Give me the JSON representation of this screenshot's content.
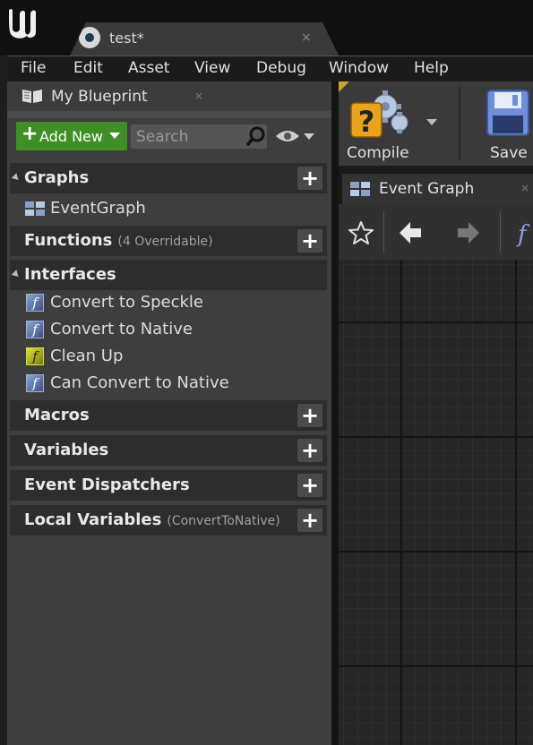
{
  "window": {
    "doc_tab_title": "test*",
    "doc_tab_close": "×"
  },
  "menu": {
    "items": [
      "File",
      "Edit",
      "Asset",
      "View",
      "Debug",
      "Window",
      "Help"
    ]
  },
  "my_blueprint": {
    "tab_label": "My Blueprint",
    "tab_close": "×",
    "add_new_label": "Add New",
    "search_placeholder": "Search",
    "sections": [
      {
        "title": "Graphs",
        "subtitle": "",
        "expanded": true,
        "items": [
          {
            "label": "EventGraph",
            "icon": "event-graph-icon"
          }
        ]
      },
      {
        "title": "Functions",
        "subtitle": "(4 Overridable)",
        "expanded": false,
        "items": []
      },
      {
        "title": "Interfaces",
        "subtitle": "",
        "expanded": true,
        "items": [
          {
            "label": "Convert to Speckle",
            "icon": "function-icon"
          },
          {
            "label": "Convert to Native",
            "icon": "function-icon"
          },
          {
            "label": "Clean Up",
            "icon": "function-icon-yellow"
          },
          {
            "label": "Can Convert to Native",
            "icon": "function-icon"
          }
        ]
      },
      {
        "title": "Macros",
        "subtitle": "",
        "expanded": false,
        "items": []
      },
      {
        "title": "Variables",
        "subtitle": "",
        "expanded": false,
        "items": []
      },
      {
        "title": "Event Dispatchers",
        "subtitle": "",
        "expanded": false,
        "items": []
      },
      {
        "title": "Local Variables",
        "subtitle": "(ConvertToNative)",
        "expanded": false,
        "items": []
      }
    ]
  },
  "toolbar": {
    "compile_label": "Compile",
    "save_label": "Save"
  },
  "graph": {
    "tab_label": "Event Graph",
    "tab_close": "×"
  },
  "colors": {
    "add_new_green": "#3f8f27",
    "compile_badge_orange": "#e8a21c",
    "function_icon_blue": "#5a70a8",
    "function_icon_yellow": "#c8c820"
  }
}
